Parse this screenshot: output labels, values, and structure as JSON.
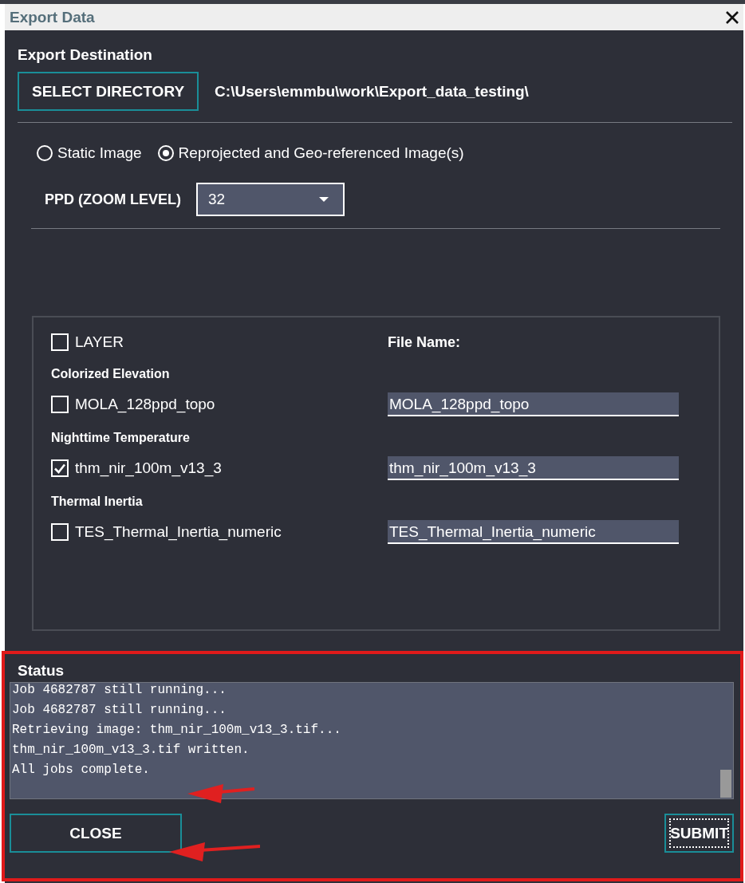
{
  "window": {
    "title": "Export Data"
  },
  "destination": {
    "label": "Export Destination",
    "button": "SELECT DIRECTORY",
    "path": "C:\\Users\\emmbu\\work\\Export_data_testing\\"
  },
  "modes": [
    {
      "label": "Static Image",
      "selected": false
    },
    {
      "label": "Reprojected and Geo-referenced Image(s)",
      "selected": true
    }
  ],
  "ppd": {
    "label": "PPD (ZOOM LEVEL)",
    "value": "32"
  },
  "layers": {
    "header": {
      "label": "LAYER",
      "checked": false
    },
    "file_name_header": "File Name:",
    "groups": [
      {
        "title": "Colorized Elevation",
        "items": [
          {
            "name": "MOLA_128ppd_topo",
            "checked": false,
            "file_name": "MOLA_128ppd_topo"
          }
        ]
      },
      {
        "title": "Nighttime Temperature",
        "items": [
          {
            "name": "thm_nir_100m_v13_3",
            "checked": true,
            "file_name": "thm_nir_100m_v13_3"
          }
        ]
      },
      {
        "title": "Thermal Inertia",
        "items": [
          {
            "name": "TES_Thermal_Inertia_numeric",
            "checked": false,
            "file_name": "TES_Thermal_Inertia_numeric"
          }
        ]
      }
    ]
  },
  "status": {
    "label": "Status",
    "lines": [
      "Job 4682787 still running...",
      "Job 4682787 still running...",
      "Retrieving image: thm_nir_100m_v13_3.tif...",
      "thm_nir_100m_v13_3.tif written.",
      "All jobs complete."
    ]
  },
  "buttons": {
    "close": "CLOSE",
    "submit": "SUBMIT"
  }
}
